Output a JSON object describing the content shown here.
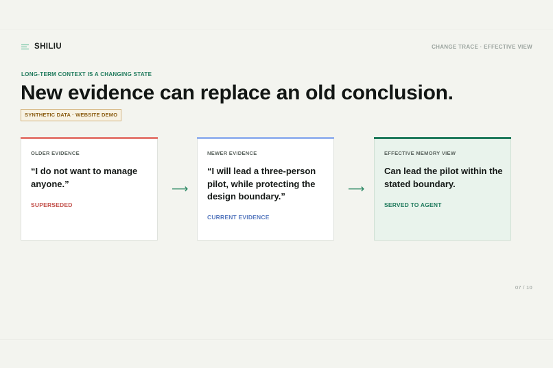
{
  "brand": {
    "name": "SHILIU",
    "icon": "menu-lines-icon",
    "accent": "#47b58a"
  },
  "header": {
    "right_label": "CHANGE TRACE · EFFECTIVE VIEW"
  },
  "slide": {
    "kicker": "LONG-TERM CONTEXT IS A CHANGING STATE",
    "headline": "New evidence can replace an old conclusion.",
    "badge": "SYNTHETIC DATA · WEBSITE DEMO",
    "page_number": "07 / 10"
  },
  "cards": [
    {
      "label": "OLDER EVIDENCE",
      "quote": "“I do not want to manage anyone.”",
      "status": "SUPERSEDED",
      "bar_color": "#e47a72",
      "status_color": "#c2504a"
    },
    {
      "label": "NEWER EVIDENCE",
      "quote": "“I will lead a three-person pilot, while protecting the design boundary.”",
      "status": "CURRENT EVIDENCE",
      "bar_color": "#97b3ee",
      "status_color": "#5678be"
    },
    {
      "label": "EFFECTIVE MEMORY VIEW",
      "quote": "Can lead the pilot within the stated boundary.",
      "status": "SERVED TO AGENT",
      "bar_color": "#1f7a5c",
      "status_color": "#1f7a5c"
    }
  ],
  "arrows": [
    {
      "icon": "arrow-right-icon",
      "glyph": "⟶"
    },
    {
      "icon": "arrow-right-icon",
      "glyph": "⟶"
    }
  ]
}
